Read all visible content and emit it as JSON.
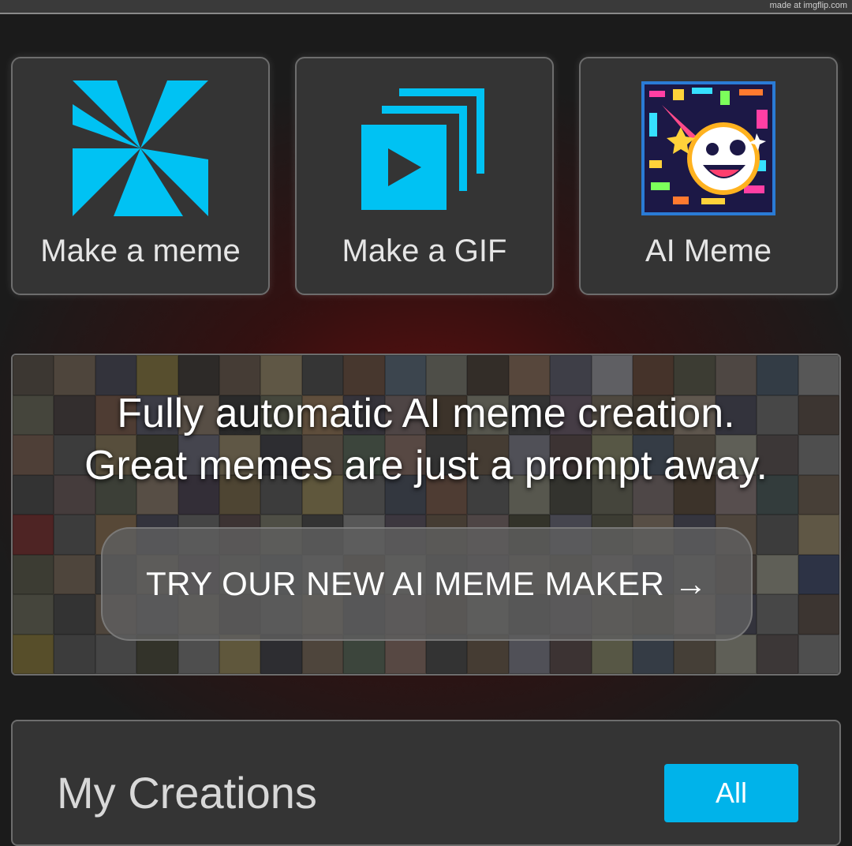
{
  "watermark": "made at imgflip.com",
  "tiles": [
    {
      "label": "Make a meme",
      "icon": "pinwheel-icon"
    },
    {
      "label": "Make a GIF",
      "icon": "gif-layers-icon"
    },
    {
      "label": "AI Meme",
      "icon": "ai-meme-thumbnail"
    }
  ],
  "banner": {
    "line1": "Fully automatic AI meme creation.",
    "line2": "Great memes are just a prompt away.",
    "cta": "TRY OUR NEW AI MEME MAKER →"
  },
  "creations": {
    "title": "My Creations",
    "filter_button": "All"
  },
  "colors": {
    "accent": "#00b3ea",
    "tile_bg": "#343434",
    "page_bg": "#1b1b1b",
    "glow": "#7a0a0a"
  }
}
